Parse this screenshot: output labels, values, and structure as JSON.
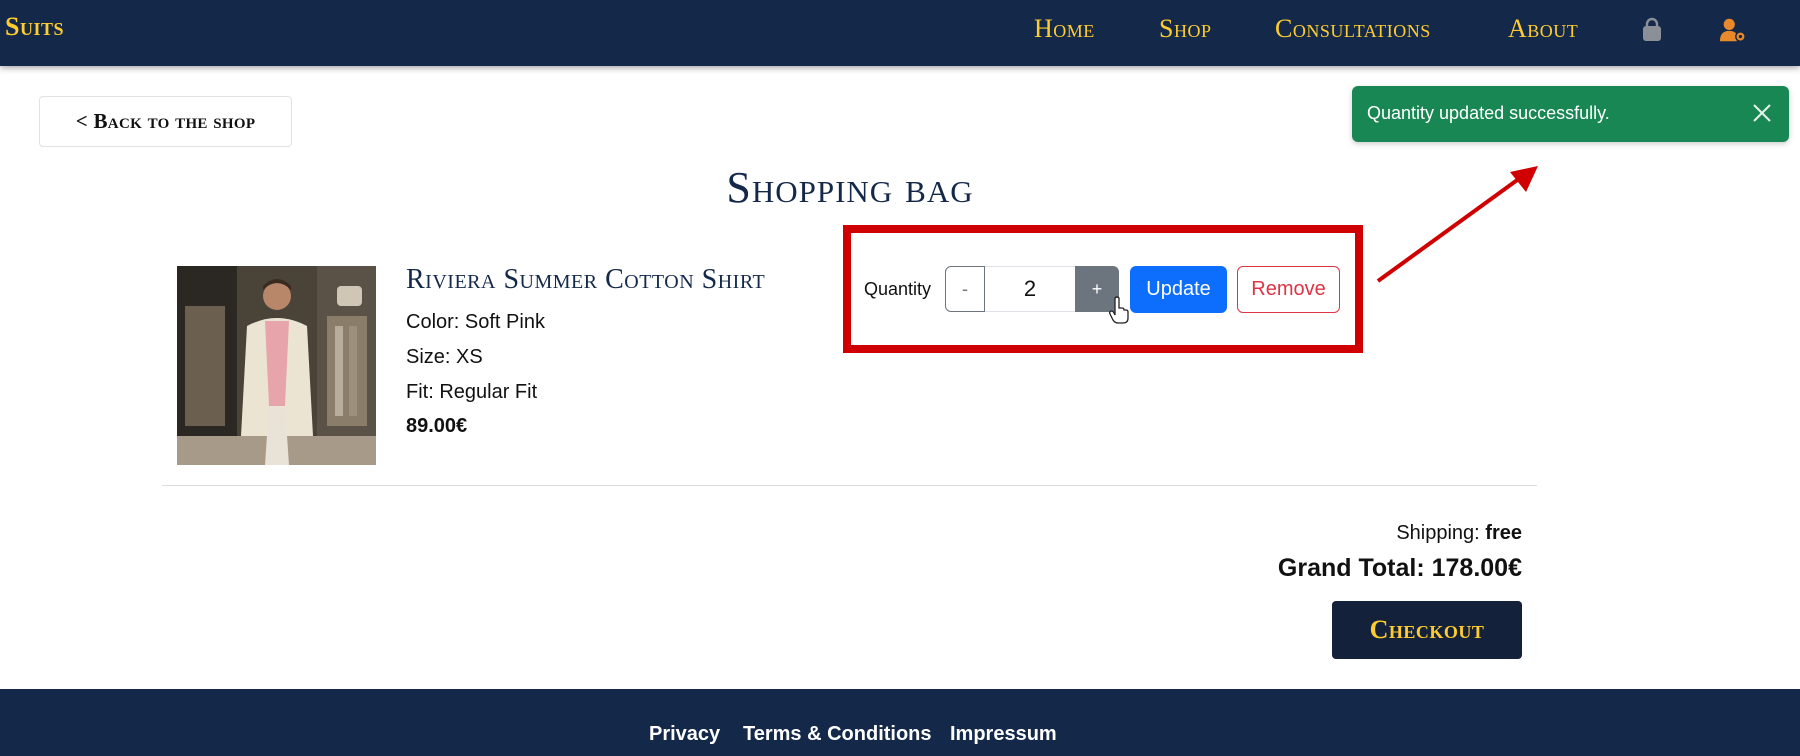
{
  "navbar": {
    "brand": "Suits",
    "links": [
      "Home",
      "Shop",
      "Consultations",
      "About"
    ],
    "icons": [
      "shopping-bag-icon",
      "user-settings-icon"
    ],
    "bg_color": "#14294a",
    "accent_color": "#ffcc2f"
  },
  "back_button": {
    "label": "< Back to the shop"
  },
  "page_title": "Shopping bag",
  "cart_item": {
    "name": "Riviera Summer Cotton Shirt",
    "color": "Color: Soft Pink",
    "size": "Size: XS",
    "fit": "Fit: Regular Fit",
    "price": "89.00€",
    "quantity_label": "Quantity",
    "quantity_value": "2",
    "minus_label": "-",
    "plus_label": "+",
    "update_label": "Update",
    "remove_label": "Remove"
  },
  "toast": {
    "message": "Quantity updated successfully.",
    "color": "#198754"
  },
  "totals": {
    "shipping_label": "Shipping:",
    "shipping_value": "free",
    "grand_total_label": "Grand Total:",
    "grand_total_value": "178.00€"
  },
  "checkout_label": "Checkout",
  "footer": {
    "links": [
      "Privacy",
      "Terms & Conditions",
      "Impressum"
    ]
  }
}
